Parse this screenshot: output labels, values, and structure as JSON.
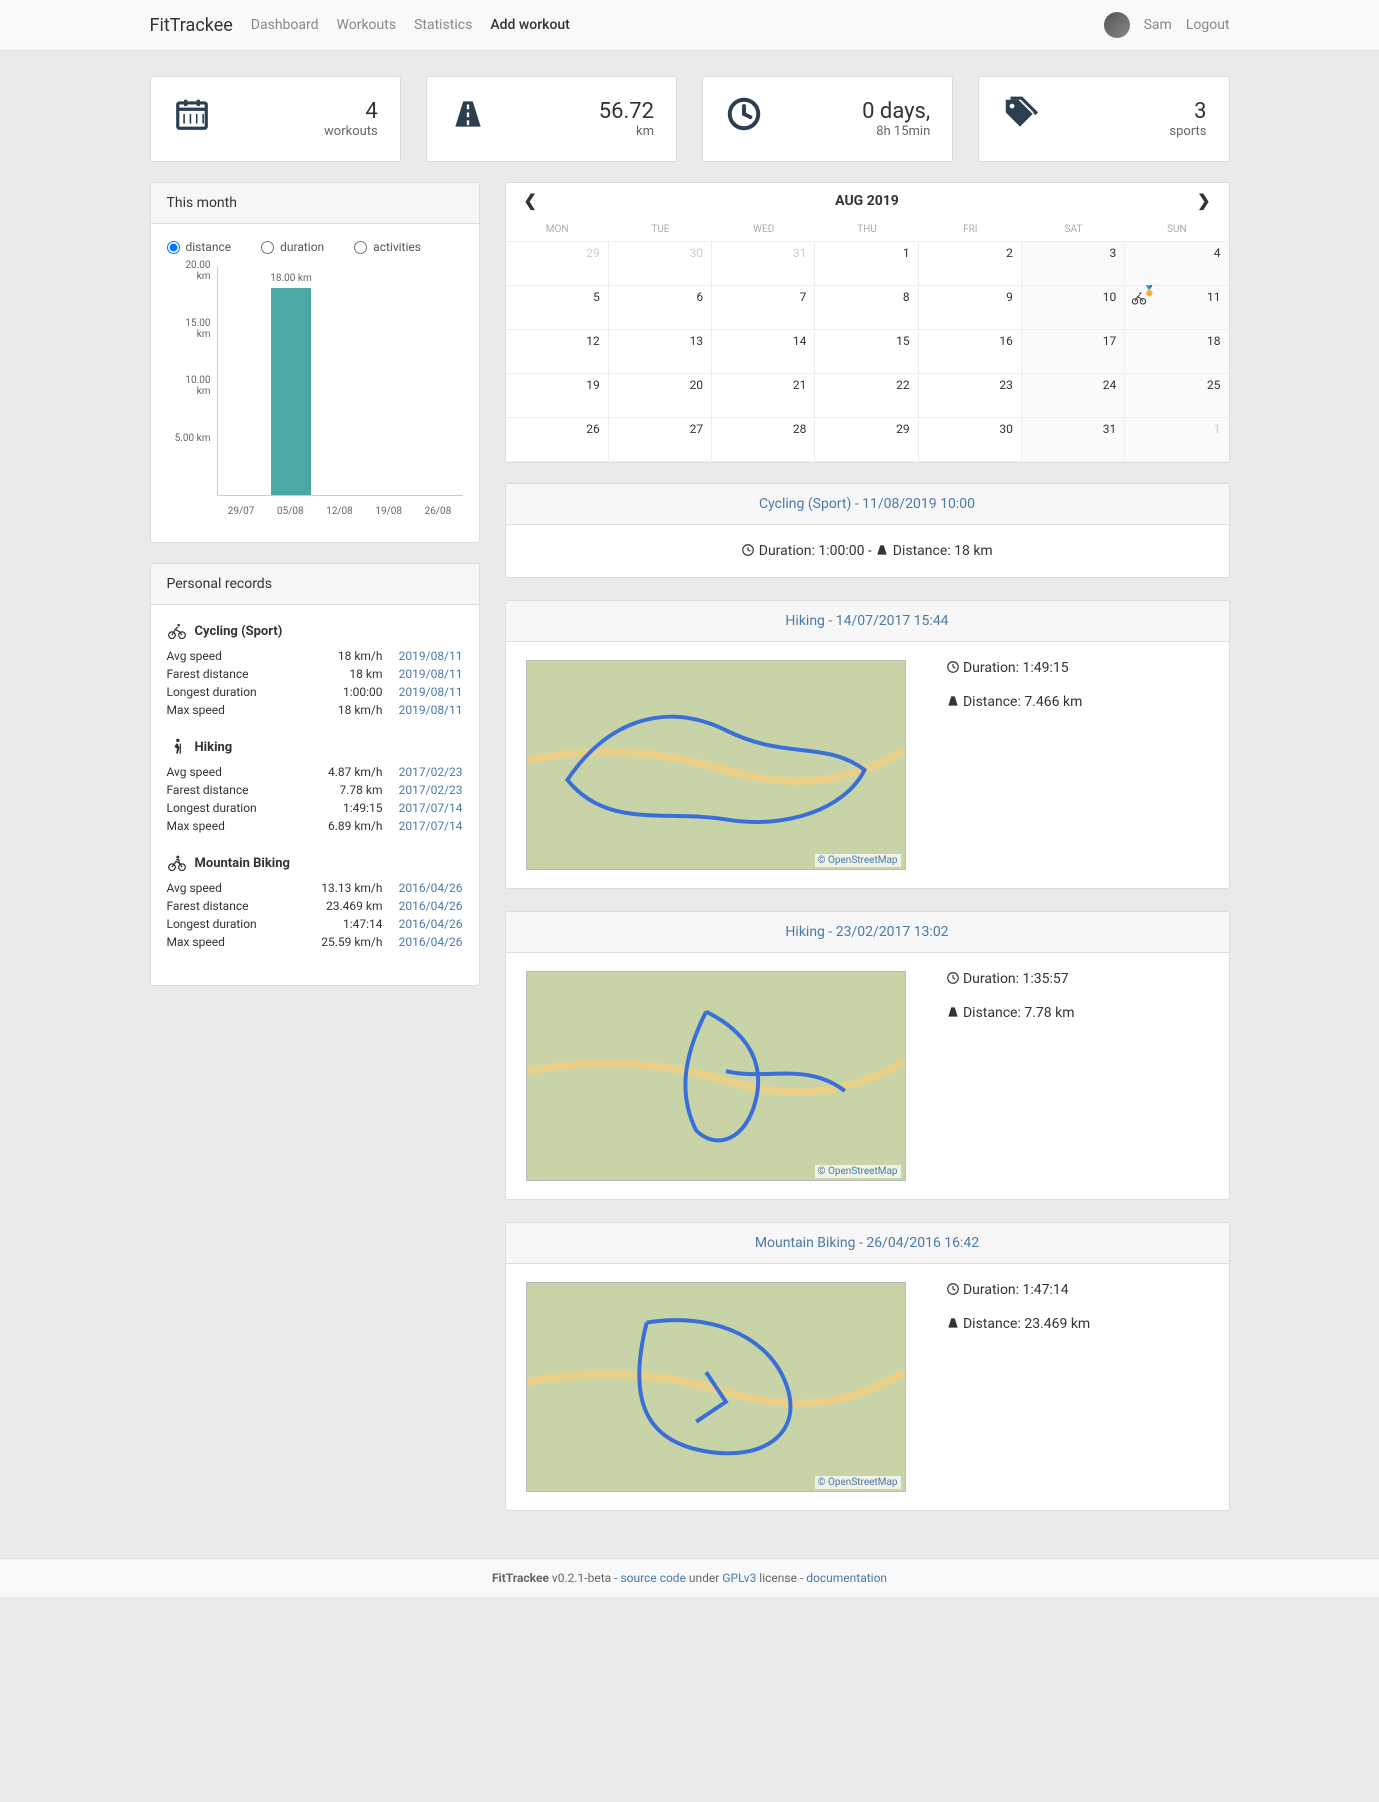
{
  "nav": {
    "brand": "FitTrackee",
    "links": [
      "Dashboard",
      "Workouts",
      "Statistics",
      "Add workout"
    ],
    "active_index": 3,
    "user": "Sam",
    "logout": "Logout"
  },
  "stats": [
    {
      "icon": "calendar",
      "value": "4",
      "label": "workouts"
    },
    {
      "icon": "road",
      "value": "56.72",
      "label": "km"
    },
    {
      "icon": "clock",
      "value": "0 days,",
      "label": "8h 15min"
    },
    {
      "icon": "tags",
      "value": "3",
      "label": "sports"
    }
  ],
  "month_panel": {
    "title": "This month",
    "radios": [
      "distance",
      "duration",
      "activities"
    ],
    "selected_radio": 0
  },
  "chart_data": {
    "type": "bar",
    "categories": [
      "29/07",
      "05/08",
      "12/08",
      "19/08",
      "26/08"
    ],
    "values": [
      0,
      18.0,
      0,
      0,
      0
    ],
    "ylabel": "km",
    "ylim": [
      0,
      20
    ],
    "y_ticks": [
      "5.00 km",
      "10.00 km",
      "15.00 km",
      "20.00 km"
    ],
    "bar_label": "18.00 km",
    "bar_color": "#4aa9a4"
  },
  "records": {
    "title": "Personal records",
    "sports": [
      {
        "name": "Cycling (Sport)",
        "icon": "cycling",
        "rows": [
          {
            "label": "Avg speed",
            "value": "18 km/h",
            "date": "2019/08/11"
          },
          {
            "label": "Farest distance",
            "value": "18 km",
            "date": "2019/08/11"
          },
          {
            "label": "Longest duration",
            "value": "1:00:00",
            "date": "2019/08/11"
          },
          {
            "label": "Max speed",
            "value": "18 km/h",
            "date": "2019/08/11"
          }
        ]
      },
      {
        "name": "Hiking",
        "icon": "hiking",
        "rows": [
          {
            "label": "Avg speed",
            "value": "4.87 km/h",
            "date": "2017/02/23"
          },
          {
            "label": "Farest distance",
            "value": "7.78 km",
            "date": "2017/02/23"
          },
          {
            "label": "Longest duration",
            "value": "1:49:15",
            "date": "2017/07/14"
          },
          {
            "label": "Max speed",
            "value": "6.89 km/h",
            "date": "2017/07/14"
          }
        ]
      },
      {
        "name": "Mountain Biking",
        "icon": "mtb",
        "rows": [
          {
            "label": "Avg speed",
            "value": "13.13 km/h",
            "date": "2016/04/26"
          },
          {
            "label": "Farest distance",
            "value": "23.469 km",
            "date": "2016/04/26"
          },
          {
            "label": "Longest duration",
            "value": "1:47:14",
            "date": "2016/04/26"
          },
          {
            "label": "Max speed",
            "value": "25.59 km/h",
            "date": "2016/04/26"
          }
        ]
      }
    ]
  },
  "calendar": {
    "title": "AUG 2019",
    "day_headers": [
      "MON",
      "TUE",
      "WED",
      "THU",
      "FRI",
      "SAT",
      "SUN"
    ],
    "weeks": [
      [
        {
          "d": "29",
          "o": true
        },
        {
          "d": "30",
          "o": true
        },
        {
          "d": "31",
          "o": true
        },
        {
          "d": "1"
        },
        {
          "d": "2"
        },
        {
          "d": "3",
          "w": true
        },
        {
          "d": "4",
          "w": true
        }
      ],
      [
        {
          "d": "5"
        },
        {
          "d": "6"
        },
        {
          "d": "7"
        },
        {
          "d": "8"
        },
        {
          "d": "9"
        },
        {
          "d": "10",
          "w": true
        },
        {
          "d": "11",
          "w": true,
          "act": "cycling",
          "medal": true
        }
      ],
      [
        {
          "d": "12"
        },
        {
          "d": "13"
        },
        {
          "d": "14"
        },
        {
          "d": "15"
        },
        {
          "d": "16"
        },
        {
          "d": "17",
          "w": true
        },
        {
          "d": "18",
          "w": true
        }
      ],
      [
        {
          "d": "19"
        },
        {
          "d": "20"
        },
        {
          "d": "21"
        },
        {
          "d": "22"
        },
        {
          "d": "23"
        },
        {
          "d": "24",
          "w": true
        },
        {
          "d": "25",
          "w": true
        }
      ],
      [
        {
          "d": "26"
        },
        {
          "d": "27"
        },
        {
          "d": "28"
        },
        {
          "d": "29"
        },
        {
          "d": "30"
        },
        {
          "d": "31",
          "w": true
        },
        {
          "d": "1",
          "o": true,
          "w": true
        }
      ]
    ]
  },
  "workouts": [
    {
      "title": "Cycling (Sport) - 11/08/2019 10:00",
      "duration_label": "Duration:",
      "duration": "1:00:00",
      "distance_label": "Distance:",
      "distance": "18 km",
      "has_map": false
    },
    {
      "title": "Hiking - 14/07/2017 15:44",
      "duration_label": "Duration:",
      "duration": "1:49:15",
      "distance_label": "Distance:",
      "distance": "7.466 km",
      "has_map": true,
      "map_attribution": "© OpenStreetMap"
    },
    {
      "title": "Hiking - 23/02/2017 13:02",
      "duration_label": "Duration:",
      "duration": "1:35:57",
      "distance_label": "Distance:",
      "distance": "7.78 km",
      "has_map": true,
      "map_attribution": "© OpenStreetMap"
    },
    {
      "title": "Mountain Biking - 26/04/2016 16:42",
      "duration_label": "Duration:",
      "duration": "1:47:14",
      "distance_label": "Distance:",
      "distance": "23.469 km",
      "has_map": true,
      "map_attribution": "© OpenStreetMap"
    }
  ],
  "footer": {
    "app": "FitTrackee",
    "version": " v0.2.1-beta - ",
    "source": "source code",
    "under": " under ",
    "license": "GPLv3",
    "license_after": " license - ",
    "docs": "documentation"
  }
}
